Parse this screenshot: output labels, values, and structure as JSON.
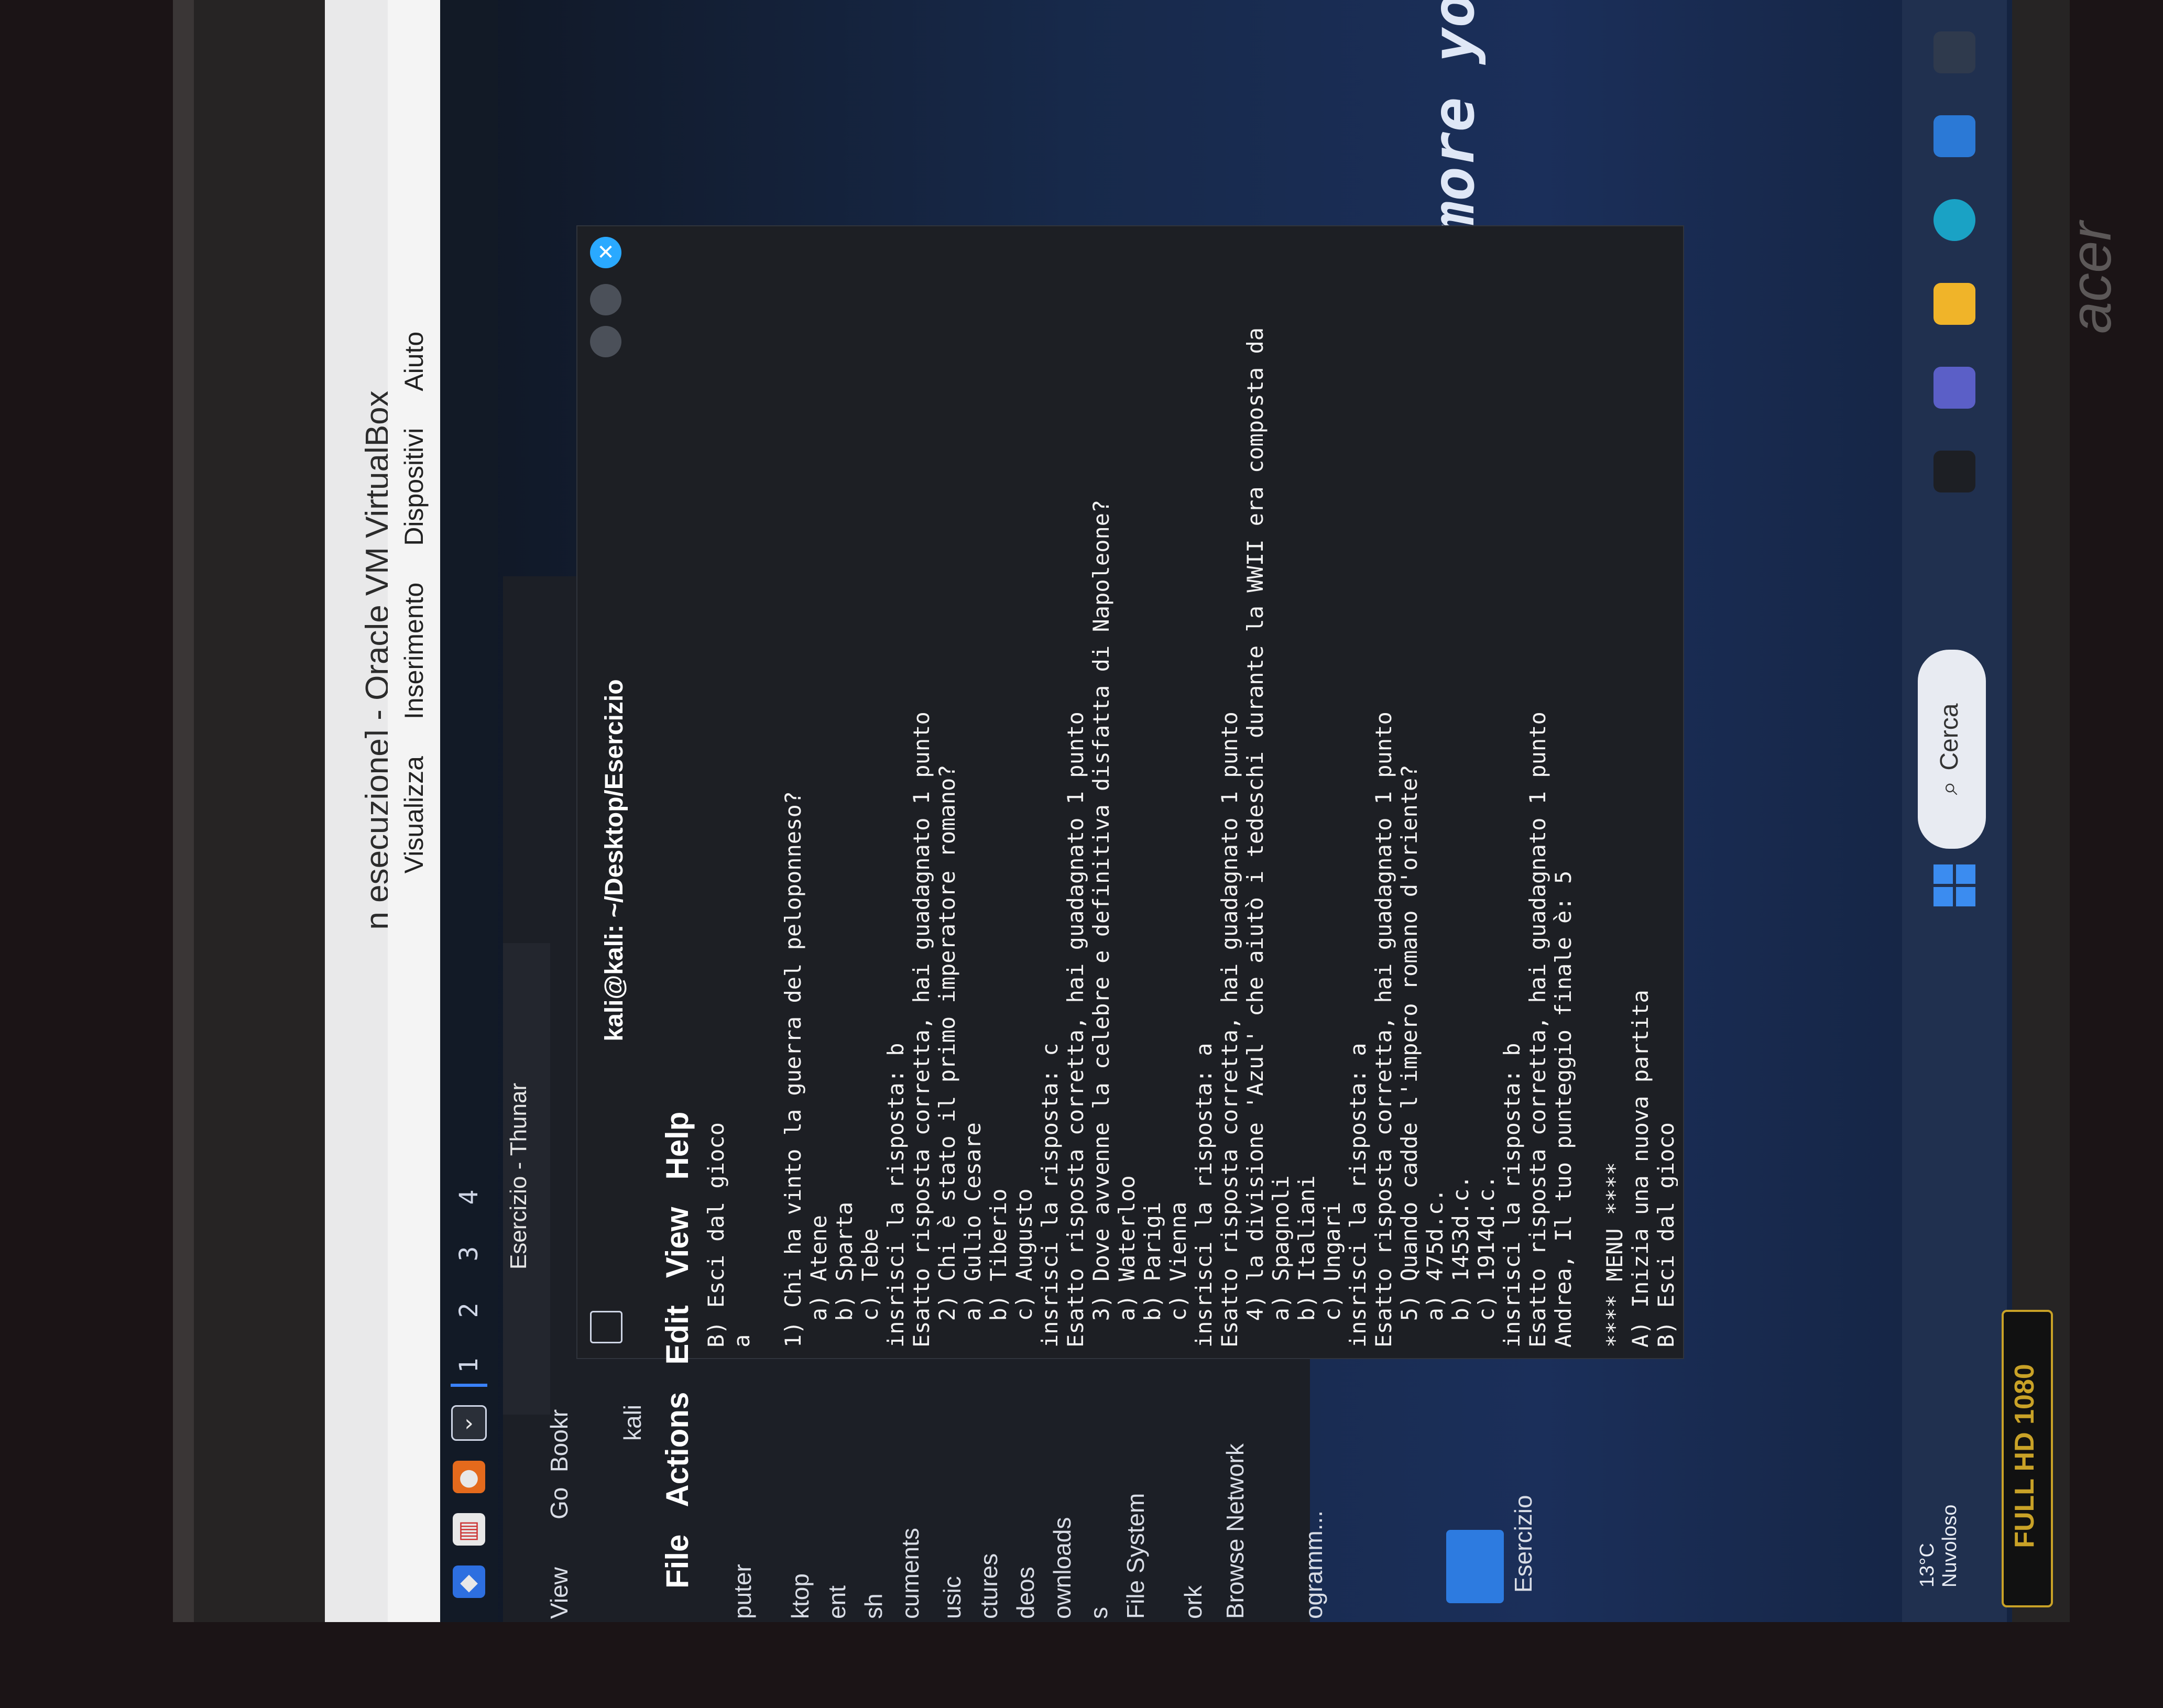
{
  "vbox": {
    "title": "n esecuzione] - Oracle VM VirtualBox",
    "menu": [
      "Visualizza",
      "Inserimento",
      "Dispositivi",
      "Aiuto"
    ]
  },
  "kali_panel": {
    "workspaces": [
      "1",
      "2",
      "3",
      "4"
    ],
    "active_workspace": "1"
  },
  "thunar": {
    "title": "Esercizio - Thunar",
    "menu": [
      "View",
      "Go",
      "Bookr"
    ],
    "location": "kali",
    "sidebar": [
      "puter",
      "ktop",
      "ent",
      "sh",
      "cuments",
      "usic",
      "ctures",
      "deos",
      "ownloads",
      "s",
      "File System",
      "ork",
      "Browse Network",
      "ogramm...",
      "Esercizio"
    ]
  },
  "terminal": {
    "title": "kali@kali: ~/Desktop/Esercizio",
    "menu": [
      "File",
      "Actions",
      "Edit",
      "View",
      "Help"
    ],
    "lines": [
      "B) Esci dal gioco",
      "a",
      "",
      "1) Chi ha vinto la guerra del peloponneso?",
      "  a) Atene",
      "  b) Sparta",
      "  c) Tebe",
      "insrisci la risposta: b",
      "Esatto risposta corretta, hai guadagnato 1 punto",
      "  2) Chi è stato il primo imperatore romano?",
      "  a) Gulio Cesare",
      "  b) Tiberio",
      "  c) Augusto",
      "insrisci la risposta: c",
      "Esatto risposta corretta, hai guadagnato 1 punto",
      "  3) Dove avvenne la celebre e definitiva disfatta di Napoleone?",
      "  a) Waterloo",
      "  b) Parigi",
      "  c) Vienna",
      "insrisci la risposta: a",
      "Esatto risposta corretta, hai guadagnato 1 punto",
      "  4) la divisione 'Azul' che aiutò i tedeschi durante la WWII era composta da",
      "  a) Spagnoli",
      "  b) Italiani",
      "  c) Ungari",
      "insrisci la risposta: a",
      "Esatto risposta corretta, hai guadagnato 1 punto",
      "  5) Quando cadde l'impero romano d'oriente?",
      "  a) 475d.c.",
      "  b) 1453d.c.",
      "  c) 1914d.c.",
      "insrisci la risposta: b",
      "Esatto risposta corretta, hai guadagnato 1 punto",
      "Andrea, Il tuo punteggio finale è: 5",
      "",
      "**** MENU ****",
      "A) Inizia una nuova partita",
      "B) Esci dal gioco"
    ]
  },
  "wallpaper": {
    "text": "ne, the more yo"
  },
  "host_taskbar": {
    "search_label": "Cerca",
    "weather_temp": "13°C",
    "weather_desc": "Nuvoloso"
  },
  "hardware": {
    "sticker": "FULL HD 1080",
    "brand": "acer"
  },
  "colors": {
    "terminal_bg": "#1d1f24",
    "terminal_fg": "#f2f2f2",
    "accent_blue": "#3a82ff",
    "close_button": "#2aa9ff"
  }
}
